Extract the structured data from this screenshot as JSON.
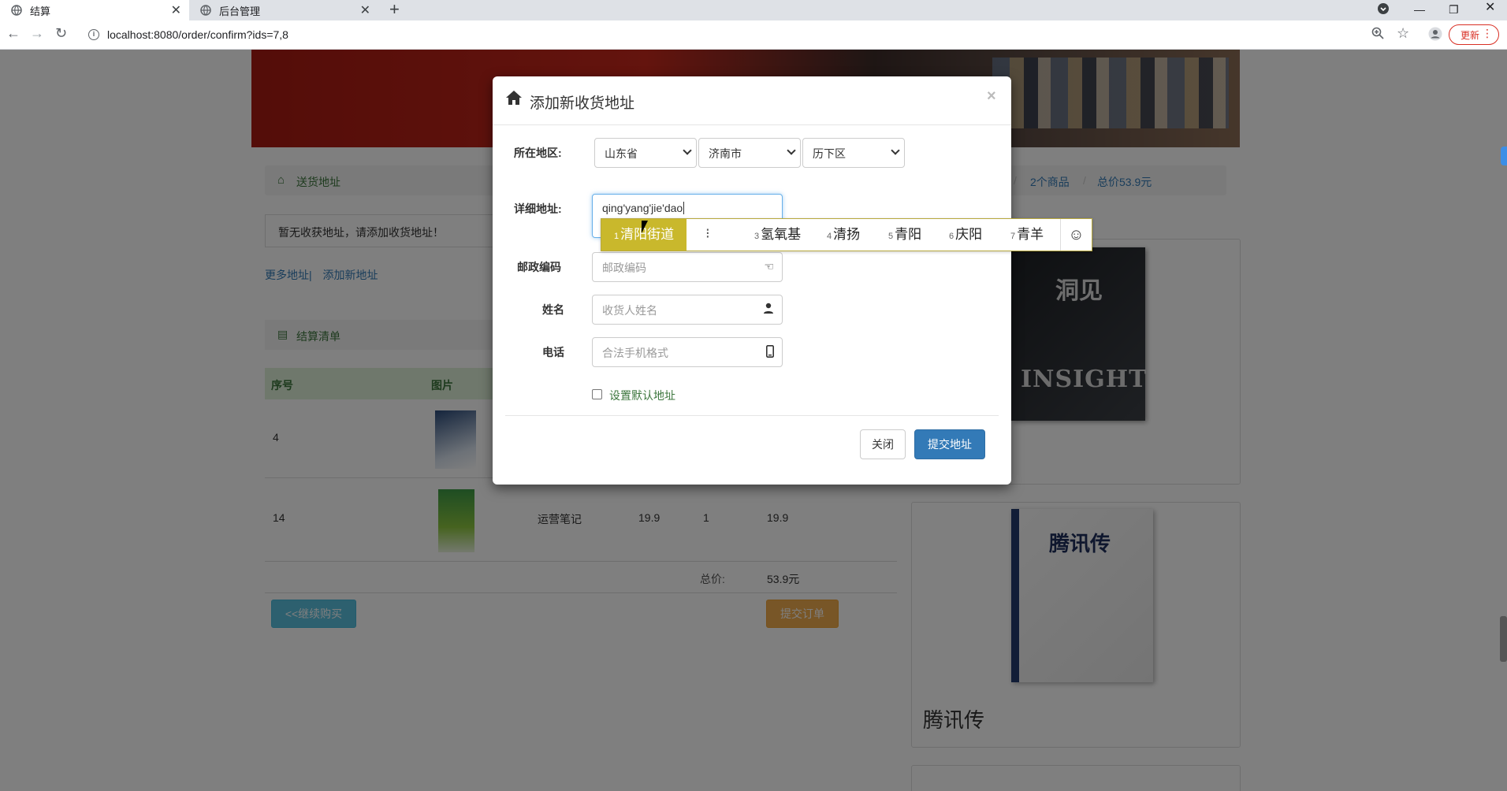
{
  "browser": {
    "tabs": [
      {
        "title": "结算",
        "active": true
      },
      {
        "title": "后台管理",
        "active": false
      }
    ],
    "url": "localhost:8080/order/confirm?ids=7,8",
    "update_label": "更新"
  },
  "page": {
    "breadcrumb": {
      "title": "送货地址",
      "items": [
        "2个商品",
        "总价53.9元"
      ]
    },
    "no_address_msg": "暂无收获地址，请添加收货地址！",
    "links": {
      "more": "更多地址",
      "sep": "|",
      "add": "添加新地址"
    },
    "checkout_list_title": "结算清单",
    "table": {
      "headers": [
        "序号",
        "图片"
      ],
      "rows": [
        {
          "no": "4",
          "name": "",
          "price": "",
          "qty": "",
          "subtotal": ""
        },
        {
          "no": "14",
          "name": "运营笔记",
          "price": "19.9",
          "qty": "1",
          "subtotal": "19.9"
        }
      ],
      "total_label": "总价:",
      "total_value": "53.9元"
    },
    "continue_btn": "<<继续购买",
    "submit_order_btn": "提交订单",
    "side_books": [
      {
        "cover_title": "洞见",
        "cover_subtitle": "INSIGHT",
        "caption": ""
      },
      {
        "cover_title": "腾讯传",
        "cover_subtitle": "",
        "caption": "腾讯传"
      }
    ]
  },
  "modal": {
    "title": "添加新收货地址",
    "close_x": "×",
    "region_label": "所在地区:",
    "province": "山东省",
    "city": "济南市",
    "district": "历下区",
    "detail_label": "详细地址:",
    "detail_value": "qing'yang'jie'dao",
    "zip_label": "邮政编码",
    "zip_placeholder": "邮政编码",
    "name_label": "姓名",
    "name_placeholder": "收货人姓名",
    "phone_label": "电话",
    "phone_placeholder": "合法手机格式",
    "default_label": "设置默认地址",
    "close_btn": "关闭",
    "submit_btn": "提交地址"
  },
  "ime": {
    "candidates": [
      {
        "n": "1",
        "text": "清阳街道"
      },
      {
        "n": "3",
        "text": "氢氧基"
      },
      {
        "n": "4",
        "text": "清扬"
      },
      {
        "n": "5",
        "text": "青阳"
      },
      {
        "n": "6",
        "text": "庆阳"
      },
      {
        "n": "7",
        "text": "青羊"
      }
    ]
  }
}
